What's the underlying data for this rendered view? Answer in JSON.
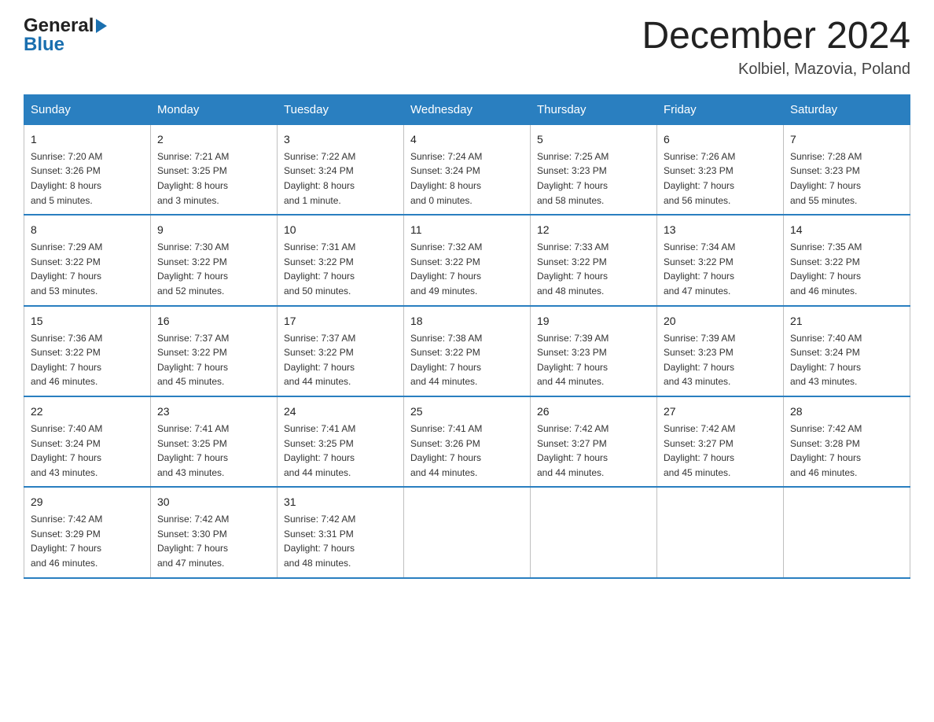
{
  "header": {
    "logo_general": "General",
    "logo_blue": "Blue",
    "month_title": "December 2024",
    "location": "Kolbiel, Mazovia, Poland"
  },
  "days_of_week": [
    "Sunday",
    "Monday",
    "Tuesday",
    "Wednesday",
    "Thursday",
    "Friday",
    "Saturday"
  ],
  "weeks": [
    [
      {
        "day": "1",
        "sunrise": "7:20 AM",
        "sunset": "3:26 PM",
        "daylight": "8 hours and 5 minutes."
      },
      {
        "day": "2",
        "sunrise": "7:21 AM",
        "sunset": "3:25 PM",
        "daylight": "8 hours and 3 minutes."
      },
      {
        "day": "3",
        "sunrise": "7:22 AM",
        "sunset": "3:24 PM",
        "daylight": "8 hours and 1 minute."
      },
      {
        "day": "4",
        "sunrise": "7:24 AM",
        "sunset": "3:24 PM",
        "daylight": "8 hours and 0 minutes."
      },
      {
        "day": "5",
        "sunrise": "7:25 AM",
        "sunset": "3:23 PM",
        "daylight": "7 hours and 58 minutes."
      },
      {
        "day": "6",
        "sunrise": "7:26 AM",
        "sunset": "3:23 PM",
        "daylight": "7 hours and 56 minutes."
      },
      {
        "day": "7",
        "sunrise": "7:28 AM",
        "sunset": "3:23 PM",
        "daylight": "7 hours and 55 minutes."
      }
    ],
    [
      {
        "day": "8",
        "sunrise": "7:29 AM",
        "sunset": "3:22 PM",
        "daylight": "7 hours and 53 minutes."
      },
      {
        "day": "9",
        "sunrise": "7:30 AM",
        "sunset": "3:22 PM",
        "daylight": "7 hours and 52 minutes."
      },
      {
        "day": "10",
        "sunrise": "7:31 AM",
        "sunset": "3:22 PM",
        "daylight": "7 hours and 50 minutes."
      },
      {
        "day": "11",
        "sunrise": "7:32 AM",
        "sunset": "3:22 PM",
        "daylight": "7 hours and 49 minutes."
      },
      {
        "day": "12",
        "sunrise": "7:33 AM",
        "sunset": "3:22 PM",
        "daylight": "7 hours and 48 minutes."
      },
      {
        "day": "13",
        "sunrise": "7:34 AM",
        "sunset": "3:22 PM",
        "daylight": "7 hours and 47 minutes."
      },
      {
        "day": "14",
        "sunrise": "7:35 AM",
        "sunset": "3:22 PM",
        "daylight": "7 hours and 46 minutes."
      }
    ],
    [
      {
        "day": "15",
        "sunrise": "7:36 AM",
        "sunset": "3:22 PM",
        "daylight": "7 hours and 46 minutes."
      },
      {
        "day": "16",
        "sunrise": "7:37 AM",
        "sunset": "3:22 PM",
        "daylight": "7 hours and 45 minutes."
      },
      {
        "day": "17",
        "sunrise": "7:37 AM",
        "sunset": "3:22 PM",
        "daylight": "7 hours and 44 minutes."
      },
      {
        "day": "18",
        "sunrise": "7:38 AM",
        "sunset": "3:22 PM",
        "daylight": "7 hours and 44 minutes."
      },
      {
        "day": "19",
        "sunrise": "7:39 AM",
        "sunset": "3:23 PM",
        "daylight": "7 hours and 44 minutes."
      },
      {
        "day": "20",
        "sunrise": "7:39 AM",
        "sunset": "3:23 PM",
        "daylight": "7 hours and 43 minutes."
      },
      {
        "day": "21",
        "sunrise": "7:40 AM",
        "sunset": "3:24 PM",
        "daylight": "7 hours and 43 minutes."
      }
    ],
    [
      {
        "day": "22",
        "sunrise": "7:40 AM",
        "sunset": "3:24 PM",
        "daylight": "7 hours and 43 minutes."
      },
      {
        "day": "23",
        "sunrise": "7:41 AM",
        "sunset": "3:25 PM",
        "daylight": "7 hours and 43 minutes."
      },
      {
        "day": "24",
        "sunrise": "7:41 AM",
        "sunset": "3:25 PM",
        "daylight": "7 hours and 44 minutes."
      },
      {
        "day": "25",
        "sunrise": "7:41 AM",
        "sunset": "3:26 PM",
        "daylight": "7 hours and 44 minutes."
      },
      {
        "day": "26",
        "sunrise": "7:42 AM",
        "sunset": "3:27 PM",
        "daylight": "7 hours and 44 minutes."
      },
      {
        "day": "27",
        "sunrise": "7:42 AM",
        "sunset": "3:27 PM",
        "daylight": "7 hours and 45 minutes."
      },
      {
        "day": "28",
        "sunrise": "7:42 AM",
        "sunset": "3:28 PM",
        "daylight": "7 hours and 46 minutes."
      }
    ],
    [
      {
        "day": "29",
        "sunrise": "7:42 AM",
        "sunset": "3:29 PM",
        "daylight": "7 hours and 46 minutes."
      },
      {
        "day": "30",
        "sunrise": "7:42 AM",
        "sunset": "3:30 PM",
        "daylight": "7 hours and 47 minutes."
      },
      {
        "day": "31",
        "sunrise": "7:42 AM",
        "sunset": "3:31 PM",
        "daylight": "7 hours and 48 minutes."
      },
      null,
      null,
      null,
      null
    ]
  ],
  "labels": {
    "sunrise": "Sunrise:",
    "sunset": "Sunset:",
    "daylight": "Daylight:"
  }
}
